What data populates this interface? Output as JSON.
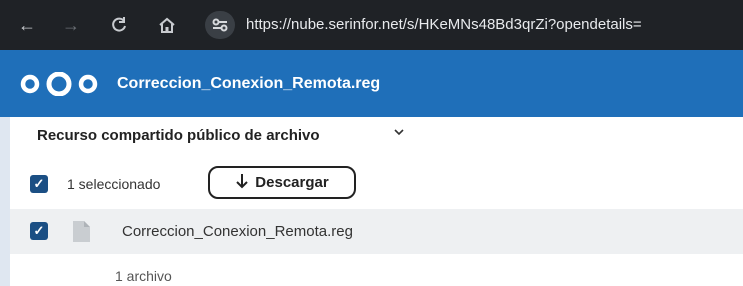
{
  "browser": {
    "url": "https://nube.serinfor.net/s/HKeMNs48Bd3qrZi?opendetails=",
    "icons": [
      "back-arrow-icon",
      "forward-arrow-icon",
      "reload-icon",
      "home-icon",
      "site-settings-icon"
    ]
  },
  "header": {
    "logo": "nextcloud-logo",
    "title": "Correccion_Conexion_Remota.reg",
    "color": "#1f6fb9"
  },
  "share": {
    "title": "Recurso compartido público de archivo"
  },
  "toolbar": {
    "selected_label": "1 seleccionado",
    "download_label": "Descargar"
  },
  "files": [
    {
      "name": "Correccion_Conexion_Remota.reg",
      "icon": "document-icon",
      "checked": true
    }
  ],
  "summary": "1 archivo"
}
